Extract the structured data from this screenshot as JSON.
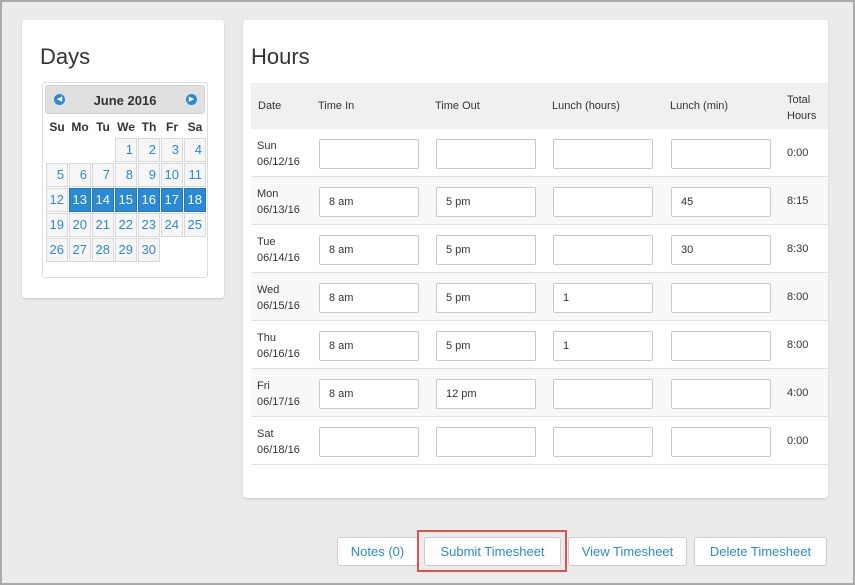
{
  "days_panel": {
    "title": "Days",
    "calendar": {
      "month_label": "June 2016",
      "prev_icon": "chevron-left-icon",
      "next_icon": "chevron-right-icon",
      "weekdays": [
        "Su",
        "Mo",
        "Tu",
        "We",
        "Th",
        "Fr",
        "Sa"
      ],
      "weeks": [
        [
          "",
          "",
          "",
          "1",
          "2",
          "3",
          "4"
        ],
        [
          "5",
          "6",
          "7",
          "8",
          "9",
          "10",
          "11"
        ],
        [
          "12",
          "13",
          "14",
          "15",
          "16",
          "17",
          "18"
        ],
        [
          "19",
          "20",
          "21",
          "22",
          "23",
          "24",
          "25"
        ],
        [
          "26",
          "27",
          "28",
          "29",
          "30",
          "",
          ""
        ]
      ],
      "selected_days": [
        "13",
        "14",
        "15",
        "16",
        "17",
        "18"
      ]
    }
  },
  "hours_panel": {
    "title": "Hours",
    "columns": [
      "Date",
      "Time In",
      "Time Out",
      "Lunch (hours)",
      "Lunch (min)",
      "Total",
      "Hours"
    ],
    "rows": [
      {
        "day": "Sun",
        "date": "06/12/16",
        "time_in": "",
        "time_out": "",
        "lunch_hours": "",
        "lunch_min": "",
        "total": "0:00"
      },
      {
        "day": "Mon",
        "date": "06/13/16",
        "time_in": "8 am",
        "time_out": "5 pm",
        "lunch_hours": "",
        "lunch_min": "45",
        "total": "8:15"
      },
      {
        "day": "Tue",
        "date": "06/14/16",
        "time_in": "8 am",
        "time_out": "5 pm",
        "lunch_hours": "",
        "lunch_min": "30",
        "total": "8:30"
      },
      {
        "day": "Wed",
        "date": "06/15/16",
        "time_in": "8 am",
        "time_out": "5 pm",
        "lunch_hours": "1",
        "lunch_min": "",
        "total": "8:00"
      },
      {
        "day": "Thu",
        "date": "06/16/16",
        "time_in": "8 am",
        "time_out": "5 pm",
        "lunch_hours": "1",
        "lunch_min": "",
        "total": "8:00"
      },
      {
        "day": "Fri",
        "date": "06/17/16",
        "time_in": "8 am",
        "time_out": "12 pm",
        "lunch_hours": "",
        "lunch_min": "",
        "total": "4:00"
      },
      {
        "day": "Sat",
        "date": "06/18/16",
        "time_in": "",
        "time_out": "",
        "lunch_hours": "",
        "lunch_min": "",
        "total": "0:00"
      }
    ]
  },
  "actions": {
    "notes_label": "Notes (0)",
    "submit_label": "Submit Timesheet",
    "view_label": "View Timesheet",
    "delete_label": "Delete Timesheet"
  },
  "colors": {
    "accent": "#2a8ad6",
    "highlight_frame": "#d9534f"
  }
}
